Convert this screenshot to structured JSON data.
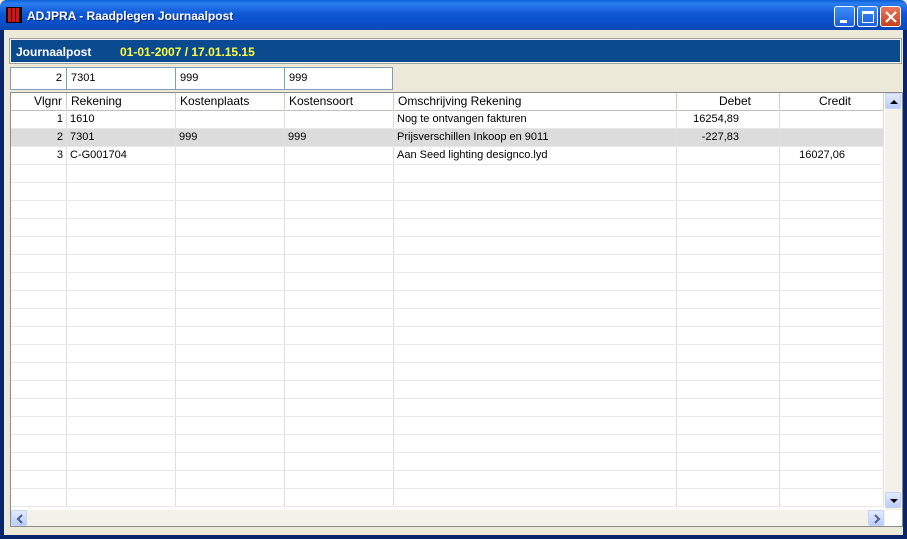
{
  "window": {
    "title": "ADJPRA - Raadplegen Journaalpost"
  },
  "header": {
    "label": "Journaalpost",
    "value": "01-01-2007 / 17.01.15.15"
  },
  "selected": {
    "vlgnr": "2",
    "rekening": "7301",
    "kostenplaats": "999",
    "kostensoort": "999"
  },
  "grid": {
    "columns": [
      "Vlgnr",
      "Rekening",
      "Kostenplaats",
      "Kostensoort",
      "Omschrijving Rekening",
      "Debet",
      "Credit"
    ],
    "rows": [
      {
        "vlgnr": "1",
        "rekening": "1610",
        "kostenplaats": "",
        "kostensoort": "",
        "omschrijving": "Nog te ontvangen fakturen",
        "debet": "16254,89",
        "credit": ""
      },
      {
        "vlgnr": "2",
        "rekening": "7301",
        "kostenplaats": "999",
        "kostensoort": "999",
        "omschrijving": "Prijsverschillen Inkoop en 9011",
        "debet": "-227,83",
        "credit": ""
      },
      {
        "vlgnr": "3",
        "rekening": "C-G001704",
        "kostenplaats": "",
        "kostensoort": "",
        "omschrijving": "Aan Seed lighting designco.lyd",
        "debet": "",
        "credit": "16027,06"
      }
    ],
    "selected_row_index": 1
  },
  "icons": {
    "app": "app-icon",
    "minimize": "minimize-icon",
    "maximize": "maximize-icon",
    "close": "close-icon"
  }
}
